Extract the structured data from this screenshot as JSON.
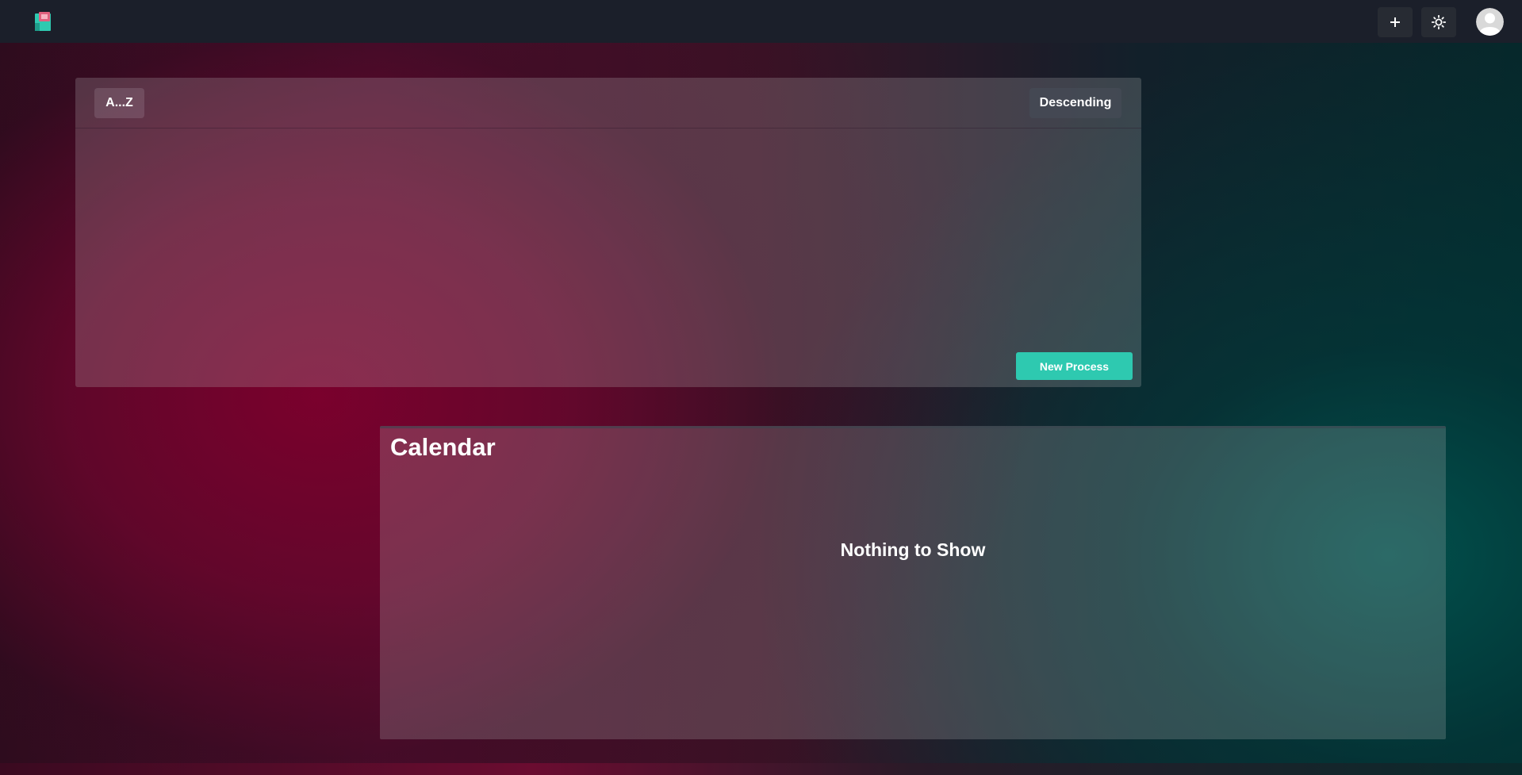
{
  "header": {
    "add_icon": "plus-icon",
    "theme_icon": "sun-icon",
    "avatar_icon": "user-avatar"
  },
  "process_panel": {
    "sort_label": "A...Z",
    "order_label": "Descending",
    "new_process_label": "New Process"
  },
  "calendar": {
    "title": "Calendar",
    "empty_message": "Nothing to Show"
  },
  "colors": {
    "accent": "#2ec9b0",
    "topbar": "#1b1f2a"
  }
}
